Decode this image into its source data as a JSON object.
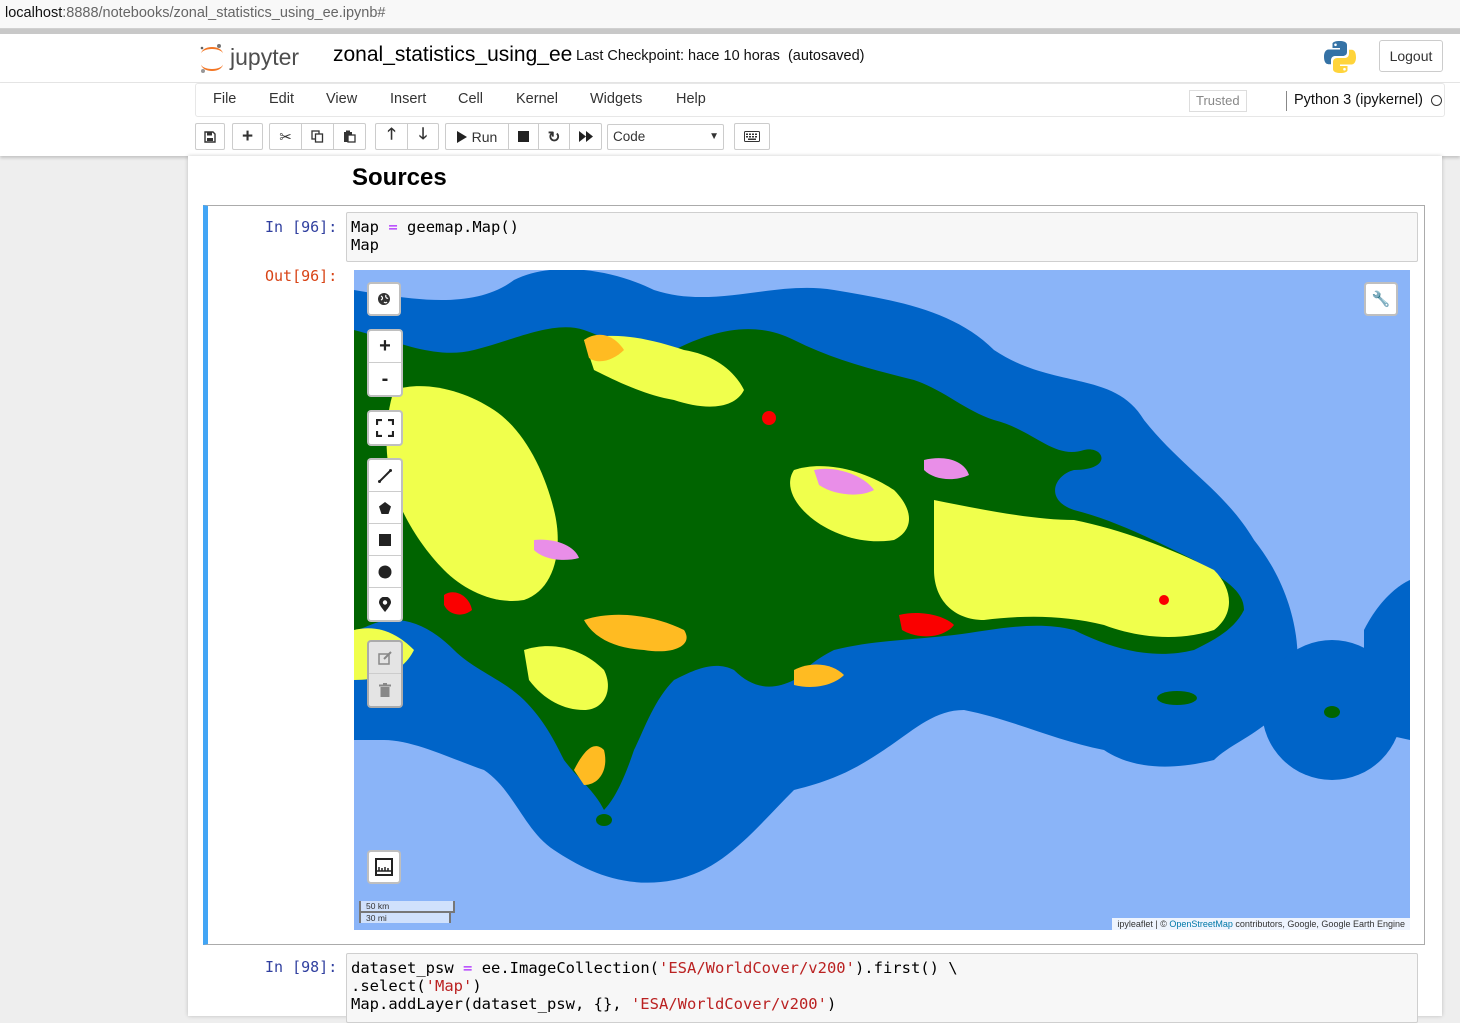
{
  "browser": {
    "url_host": "localhost",
    "url_path": ":8888/notebooks/zonal_statistics_using_ee.ipynb#"
  },
  "header": {
    "logo_text": "jupyter",
    "notebook_name": "zonal_statistics_using_ee",
    "checkpoint": "Last Checkpoint: hace 10 horas",
    "autosaved": "(autosaved)",
    "logout_label": "Logout"
  },
  "menu": {
    "items": [
      "File",
      "Edit",
      "View",
      "Insert",
      "Cell",
      "Kernel",
      "Widgets",
      "Help"
    ],
    "trusted": "Trusted",
    "kernel_name": "Python 3 (ipykernel)"
  },
  "toolbar": {
    "run_label": "Run",
    "cell_type": "Code",
    "icons": [
      "save-icon",
      "plus-icon",
      "cut-icon",
      "copy-icon",
      "paste-icon",
      "arrow-up-icon",
      "arrow-down-icon",
      "play-icon",
      "stop-icon",
      "restart-icon",
      "fast-forward-icon",
      "keyboard-icon"
    ]
  },
  "notebook": {
    "heading": "Sources",
    "cell1": {
      "prompt_in": "In [96]:",
      "code_line1_var": "Map",
      "code_line1_op": "=",
      "code_line1_rest": "geemap.Map()",
      "code_line2": "Map",
      "prompt_out": "Out[96]:"
    },
    "cell2": {
      "prompt_in": "In [98]:",
      "line1_var": "dataset_psw",
      "line1_op": "=",
      "line1_pre": "ee.ImageCollection(",
      "line1_str": "'ESA/WorldCover/v200'",
      "line1_post": ").first() \\",
      "line2_pre": ".select(",
      "line2_str": "'Map'",
      "line2_post": ")",
      "line3_pre": "Map.addLayer(dataset_psw, {}, ",
      "line3_str": "'ESA/WorldCover/v200'",
      "line3_post": ")"
    }
  },
  "map": {
    "zoom_in": "+",
    "zoom_out": "-",
    "scale_km": "50 km",
    "scale_mi": "30 mi",
    "attribution_pre": "ipyleaflet | © ",
    "attribution_link": "OpenStreetMap",
    "attribution_post": " contributors, Google, Google Earth Engine",
    "colors": {
      "ocean_light": "#8ab4f8",
      "ocean_deep": "#0064c8",
      "tree_cover": "#006400",
      "cropland": "#f0ff4c",
      "shrubland": "#ffbb22",
      "grassland": "#ffff4c",
      "built_up": "#fa0000",
      "herbaceous_wetland": "#e98ee8",
      "mangroves": "#00cf75"
    }
  }
}
